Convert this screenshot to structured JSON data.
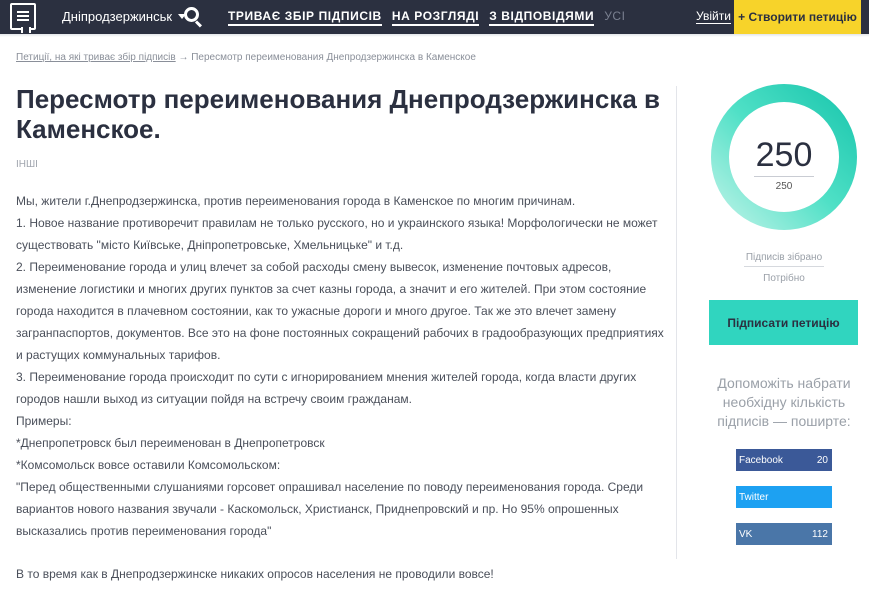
{
  "header": {
    "city": "Дніпродзержинськ",
    "nav": [
      "ТРИВАЄ ЗБІР ПІДПИСІВ",
      "НА РОЗГЛЯДІ",
      "З ВІДПОВІДЯМИ",
      "УСІ"
    ],
    "login": "Увійти",
    "create": "+ Створити петицію"
  },
  "breadcrumb": {
    "link": "Петиції, на які триває збір підписів",
    "current": "→ Пересмотр переименования Днепродзержинска в Каменское"
  },
  "petition": {
    "title": "Пересмотр переименования Днепродзержинска в Каменское.",
    "category": "ІНШІ",
    "paragraphs": [
      "Мы, жители г.Днепродзержинска, против переименования города в Каменское по многим причинам.",
      "1. Новое название противоречит правилам не только русского, но и украинского языка! Морфологически не может существовать \"місто Київське, Дніпропетровське, Хмельницьке\" и т.д.",
      "2. Переименование города и улиц влечет за собой расходы смену вывесок, изменение почтовых адресов, изменение логистики и многих других пунктов за счет казны города, а значит и его жителей. При этом состояние города находится в плачевном состоянии, как то ужасные дороги и много другое. Так же это влечет замену загранпаспортов, документов. Все это на фоне постоянных сокращений рабочих в градообразующих предприятиях и растущих коммунальных тарифов.",
      "3. Переименование города происходит по сути с игнорированием мнения жителей города, когда власти других городов нашли выход из ситуации пойдя на встречу своим гражданам.",
      "Примеры:",
      "*Днепропетровск был переименован в Днепропетровск",
      "*Комсомольск вовсе оставили Комсомольском:",
      "\"Перед общественными слушаниями горсовет опрашивал население по поводу переименования города. Среди вариантов нового названия звучали - Каскомольск, Христианск, Приднепровский и пр. Но 95% опрошенных высказались против переименования города\""
    ],
    "last_paragraph": "В то время как в Днепродзержинске никаких опросов населения не проводили вовсе!"
  },
  "sidebar": {
    "signatures_collected": 250,
    "signatures_collected_text": "250",
    "signatures_needed_text": "250",
    "progress_fraction": 1.0,
    "collected_label": "Підписів зібрано",
    "needed_label": "Потрібно",
    "sign_button": "Підписати петицію",
    "share_text": "Допоможіть набрати необхідну кількість підписів — поширте:",
    "share": [
      {
        "network": "Facebook",
        "count": "20"
      },
      {
        "network": "Twitter",
        "count": ""
      },
      {
        "network": "VK",
        "count": "112"
      }
    ]
  },
  "colors": {
    "nav_bg": "#2b3040",
    "accent_yellow": "#f7d32a",
    "accent_teal": "#30d5bf",
    "facebook": "#3b5998",
    "twitter": "#1da1f2",
    "vk": "#4a76a8"
  }
}
